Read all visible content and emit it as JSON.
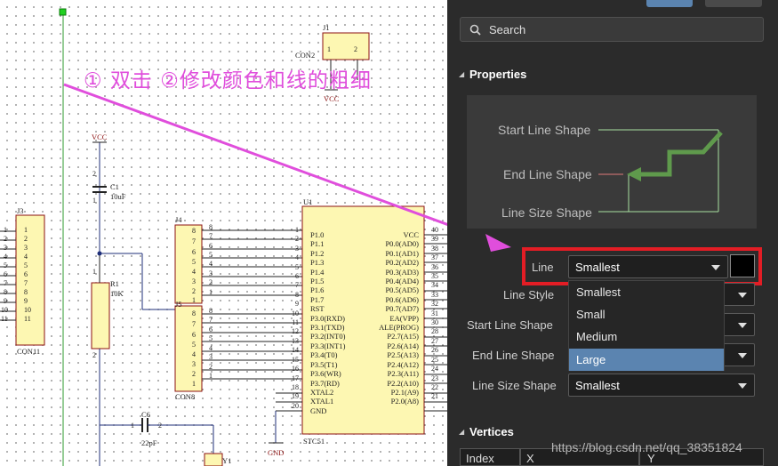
{
  "annotation": "① 双击 ②修改颜色和线的粗细",
  "schematic": {
    "j1": {
      "ref": "J1",
      "name": "CON2",
      "net": "VCC",
      "pins": [
        "1",
        "2"
      ]
    },
    "vcc_label": "VCC",
    "c1": {
      "ref": "C1",
      "value": "10uF",
      "pins": [
        "1",
        "2"
      ]
    },
    "r1": {
      "ref": "R1",
      "value": "10K",
      "pins": [
        "1",
        "2"
      ]
    },
    "j3": {
      "ref": "J3",
      "name": "CON11",
      "pins": [
        "1",
        "2",
        "3",
        "4",
        "5",
        "6",
        "7",
        "8",
        "9",
        "10",
        "11"
      ]
    },
    "j4": {
      "ref": "J4"
    },
    "j5": {
      "ref": "J5",
      "name": "CON8"
    },
    "con8_pins": [
      "8",
      "7",
      "6",
      "5",
      "4",
      "3",
      "2",
      "1"
    ],
    "u1": {
      "ref": "U1",
      "name": "STC51",
      "left_pins": [
        "P1.0",
        "P1.1",
        "P1.2",
        "P1.3",
        "P1.4",
        "P1.5",
        "P1.6",
        "P1.7",
        "RST",
        "P3.0(RXD)",
        "P3.1(TXD)",
        "P3.2(INT0)",
        "P3.3(INT1)",
        "P3.4(T0)",
        "P3.5(T1)",
        "P3.6(WR)",
        "P3.7(RD)",
        "XTAL2",
        "XTAL1",
        "GND"
      ],
      "left_nums": [
        "1",
        "2",
        "3",
        "4",
        "5",
        "6",
        "7",
        "8",
        "9",
        "10",
        "11",
        "12",
        "13",
        "14",
        "15",
        "16",
        "17",
        "18",
        "19",
        "20"
      ],
      "right_pins": [
        "VCC",
        "P0.0(AD0)",
        "P0.1(AD1)",
        "P0.2(AD2)",
        "P0.3(AD3)",
        "P0.4(AD4)",
        "P0.5(AD5)",
        "P0.6(AD6)",
        "P0.7(AD7)",
        "EA(VPP)",
        "ALE(PROG)",
        "P2.7(A15)",
        "P2.6(A14)",
        "P2.5(A13)",
        "P2.4(A12)",
        "P2.3(A11)",
        "P2.2(A10)",
        "P2.1(A9)",
        "P2.0(A8)"
      ],
      "right_nums": [
        "40",
        "39",
        "38",
        "37",
        "36",
        "35",
        "34",
        "33",
        "32",
        "31",
        "30",
        "28",
        "27",
        "26",
        "25",
        "24",
        "23",
        "22",
        "21"
      ]
    },
    "c6": {
      "ref": "C6",
      "value": "22pF",
      "pins": [
        "1",
        "2"
      ]
    },
    "y1": {
      "ref": "Y1"
    },
    "gnd_label": "GND"
  },
  "panel": {
    "search_placeholder": "Search",
    "properties_title": "Properties",
    "preview": {
      "start_line_shape": "Start Line Shape",
      "end_line_shape": "End Line Shape",
      "line_size_shape": "Line Size Shape"
    },
    "line": {
      "label": "Line",
      "value": "Smallest",
      "color": "#000000"
    },
    "line_style": {
      "label": "Line Style"
    },
    "start_line_shape": {
      "label": "Start Line Shape"
    },
    "end_line_shape": {
      "label": "End Line Shape"
    },
    "line_size_shape": {
      "label": "Line Size Shape",
      "value": "Smallest"
    },
    "dropdown_options": [
      "Smallest",
      "Small",
      "Medium",
      "Large"
    ],
    "dropdown_highlighted": "Large",
    "vertices_title": "Vertices",
    "vertices_columns": [
      "Index",
      "X",
      "Y"
    ]
  },
  "watermark": "https://blog.csdn.net/qq_38351824",
  "colors": {
    "annotation": "#e04edc",
    "highlight_box": "#e31d25",
    "selected_item": "#5b84b0",
    "component_fill": "#fdf7b2",
    "wire": "#1f2f7a",
    "preview_line": "#5f9a4c"
  }
}
